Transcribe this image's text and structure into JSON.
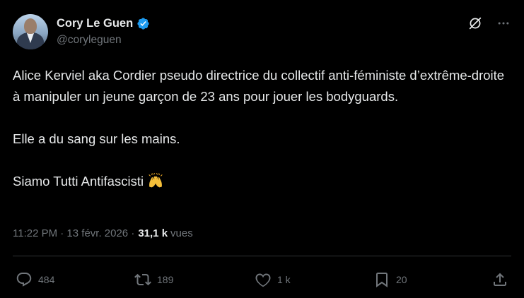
{
  "author": {
    "display_name": "Cory Le Guen",
    "handle": "@coryleguen"
  },
  "tweet": {
    "line1": "Alice Kerviel aka Cordier pseudo directrice du collectif anti-féministe d’extrême-droite à manipuler un jeune garçon de 23 ans pour jouer les bodyguards.",
    "line2": "Elle a du sang sur les mains.",
    "line3": "Siamo Tutti Antifascisti "
  },
  "meta": {
    "timestamp": "11:22 PM · 13 févr. 2026 ·",
    "views_count": "31,1 k",
    "views_label": "vues"
  },
  "actions": {
    "replies": "484",
    "reposts": "189",
    "likes": "1 k",
    "bookmarks": "20"
  },
  "icons": {
    "verified": "verified-badge-icon",
    "grok": "grok-icon",
    "more": "more-icon",
    "reply": "reply-icon",
    "repost": "repost-icon",
    "like": "heart-icon",
    "bookmark": "bookmark-icon",
    "share": "share-icon"
  },
  "colors": {
    "background": "#000000",
    "text": "#e7e9ea",
    "muted": "#71767b",
    "verified": "#1d9bf0",
    "divider": "#2f3336"
  }
}
